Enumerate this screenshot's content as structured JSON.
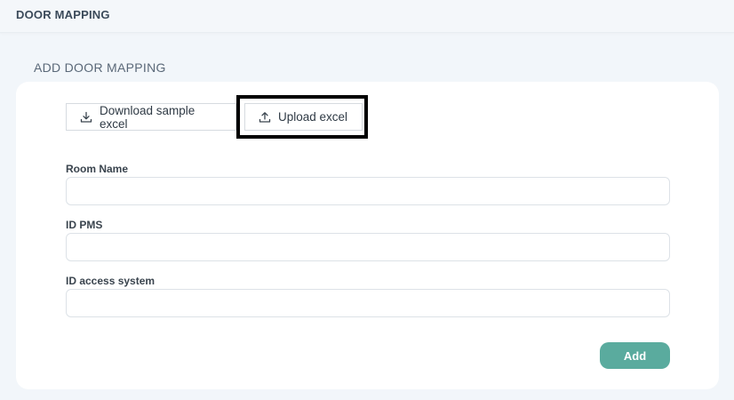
{
  "header": {
    "title": "DOOR MAPPING"
  },
  "section": {
    "title": "ADD DOOR MAPPING"
  },
  "actions": {
    "download_label": "Download sample excel",
    "download_icon": "download-icon",
    "upload_label": "Upload excel",
    "upload_icon": "upload-icon"
  },
  "form": {
    "fields": [
      {
        "label": "Room Name",
        "value": "",
        "placeholder": ""
      },
      {
        "label": "ID PMS",
        "value": "",
        "placeholder": ""
      },
      {
        "label": "ID access system",
        "value": "",
        "placeholder": ""
      }
    ],
    "submit_label": "Add"
  },
  "colors": {
    "accent": "#5aab9e",
    "background": "#f2f6fa",
    "card": "#ffffff",
    "highlight_border": "#000000"
  }
}
